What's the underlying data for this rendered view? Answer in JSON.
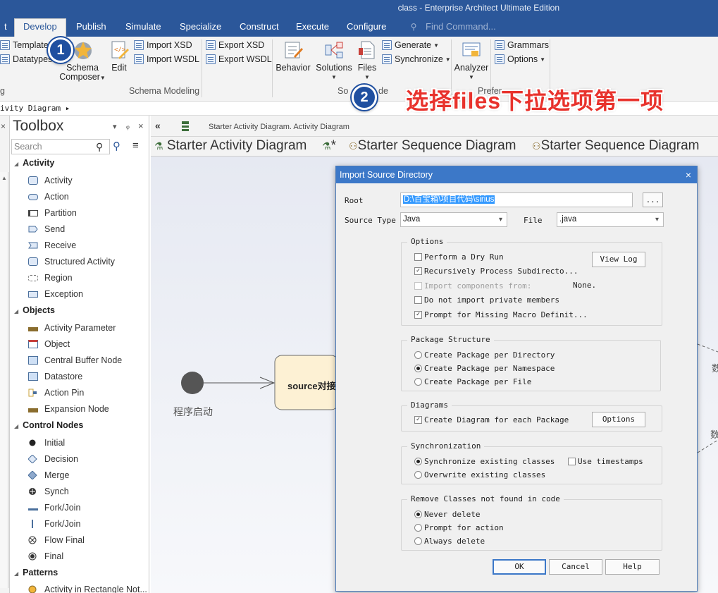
{
  "window": {
    "title": "class - Enterprise Architect Ultimate Edition"
  },
  "tabs": [
    "t",
    "Develop",
    "Publish",
    "Simulate",
    "Specialize",
    "Construct",
    "Execute",
    "Configure"
  ],
  "find_command": "Find Command...",
  "ribbon": {
    "template": "Template",
    "datatypes": "Datatypes",
    "schema_composer": "Schema",
    "schema_composer_2": "Composer",
    "edit": "Edit",
    "import_xsd": "Import XSD",
    "import_wsdl": "Import WSDL",
    "export_xsd": "Export XSD",
    "export_wsdl": "Export WSDL",
    "group_left_fragment": "g",
    "group_schema_modeling": "Schema Modeling",
    "behavior": "Behavior",
    "solutions": "Solutions",
    "files": "Files",
    "generate": "Generate",
    "synchronize": "Synchronize",
    "group_source_code_partial": "So",
    "group_source_code_tail": "de",
    "analyzer": "Analyzer",
    "grammars": "Grammars",
    "options": "Options",
    "group_preferences_partial": "Prefer"
  },
  "breadcrumb": "ivity Diagram ▸",
  "toolbox": {
    "title": "Toolbox",
    "controls": {
      "dropdown": "▾",
      "pin": "ᵩ",
      "close": "×",
      "left_close": "×"
    },
    "search_placeholder": "Search",
    "categories": [
      {
        "name": "Activity",
        "items": [
          "Activity",
          "Action",
          "Partition",
          "Send",
          "Receive",
          "Structured Activity",
          "Region",
          "Exception"
        ]
      },
      {
        "name": "Objects",
        "items": [
          "Activity Parameter",
          "Object",
          "Central Buffer Node",
          "Datastore",
          "Action Pin",
          "Expansion Node"
        ]
      },
      {
        "name": "Control Nodes",
        "items": [
          "Initial",
          "Decision",
          "Merge",
          "Synch",
          "Fork/Join",
          "Fork/Join",
          "Flow Final",
          "Final"
        ]
      },
      {
        "name": "Patterns",
        "items": [
          "Activity in Rectangle Not..."
        ]
      }
    ]
  },
  "diagram": {
    "header_caption": "Starter Activity Diagram.  Activity Diagram",
    "doc_tabs": [
      "Starter Activity Diagram",
      "*",
      "Starter Sequence Diagram",
      "Starter Sequence Diagram"
    ],
    "node_label": "source对接",
    "start_label": "程序启动",
    "right_label_1": "数",
    "right_label_2": "数"
  },
  "dialog": {
    "title": "Import Source Directory",
    "close": "×",
    "root_label": "Root",
    "root_value": "D:\\百宝箱\\项目代码\\sirius",
    "browse": "...",
    "source_type_label": "Source Type",
    "source_type_value": "Java",
    "file_label": "File",
    "file_value": ".java",
    "options": {
      "title": "Options",
      "dry_run": "Perform a Dry Run",
      "dry_run_checked": false,
      "recursive": "Recursively Process Subdirecto...",
      "recursive_checked": true,
      "import_components": "Import components from:",
      "import_components_value": "None.",
      "private_members": "Do not import private members",
      "private_members_checked": false,
      "prompt_macro": "Prompt for Missing Macro Definit...",
      "prompt_macro_checked": true,
      "view_log": "View Log"
    },
    "package_structure": {
      "title": "Package Structure",
      "per_directory": "Create Package per Directory",
      "per_namespace": "Create Package per Namespace",
      "per_file": "Create Package per File",
      "selected": "per_namespace"
    },
    "diagrams": {
      "title": "Diagrams",
      "create_diagram": "Create Diagram for each Package",
      "create_diagram_checked": true,
      "options_button": "Options"
    },
    "synchronization": {
      "title": "Synchronization",
      "sync_existing": "Synchronize existing classes",
      "overwrite_existing": "Overwrite existing classes",
      "use_timestamps": "Use timestamps",
      "selected": "sync_existing"
    },
    "remove_classes": {
      "title": "Remove Classes not found in code",
      "never": "Never delete",
      "prompt": "Prompt for action",
      "always": "Always delete",
      "selected": "never"
    },
    "ok": "OK",
    "cancel": "Cancel",
    "help": "Help"
  },
  "annotations": {
    "bubble_1": "1",
    "bubble_2": "2",
    "note": "选择files下拉选项第一项"
  },
  "colors": {
    "title_bar": "#2b579a",
    "dialog_title": "#3c78c8",
    "annotation_red": "#e8322c",
    "bubble_blue": "#1f4fa0"
  }
}
